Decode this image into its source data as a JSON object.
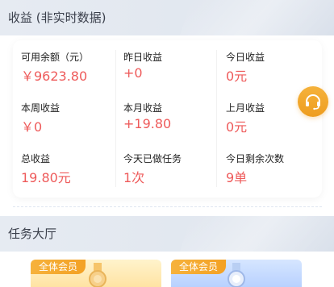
{
  "earnings": {
    "title": "收益 (非实时数据)",
    "stats": [
      {
        "label": "可用余额（元）",
        "value": "￥9623.80"
      },
      {
        "label": "昨日收益",
        "value": "+0"
      },
      {
        "label": "今日收益",
        "value": "0元"
      },
      {
        "label": "本周收益",
        "value": "￥0"
      },
      {
        "label": "本月收益",
        "value": "+19.80"
      },
      {
        "label": "上月收益",
        "value": "0元"
      },
      {
        "label": "总收益",
        "value": "19.80元"
      },
      {
        "label": "今天已做任务",
        "value": "1次"
      },
      {
        "label": "今日剩余次数",
        "value": "9单"
      }
    ]
  },
  "tasks": {
    "title": "任务大厅",
    "cards": [
      {
        "badge": "全体会员"
      },
      {
        "badge": "全体会员"
      }
    ]
  },
  "colors": {
    "value_red": "#ee5a5a",
    "support_orange": "#ee9d1f",
    "badge_orange": "#f3a124"
  },
  "icons": {
    "support": "headset-icon",
    "medal": "medal-icon"
  }
}
